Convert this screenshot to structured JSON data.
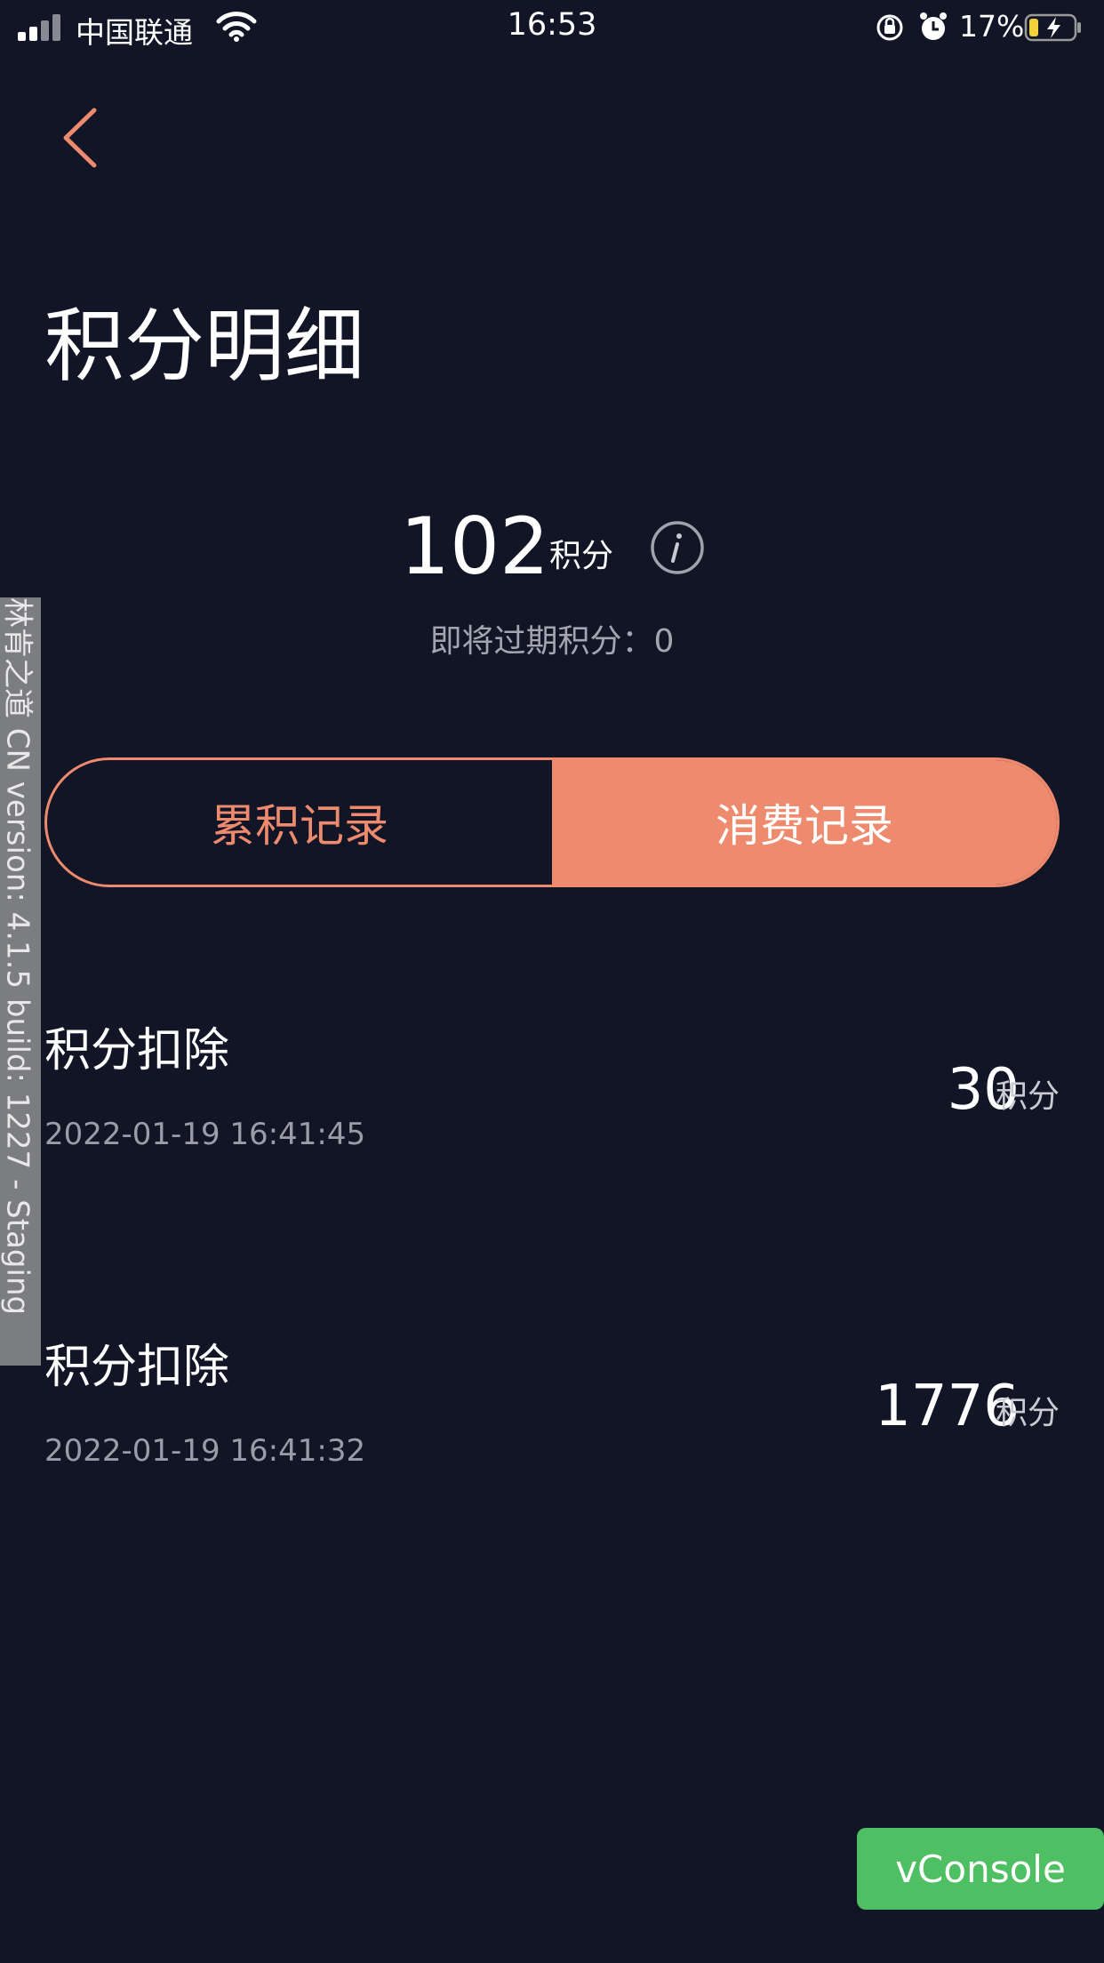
{
  "status_bar": {
    "carrier": "中国联通",
    "time": "16:53",
    "battery_percent": "17%",
    "battery_level": 0.17,
    "icons": [
      "signal-icon",
      "wifi-icon",
      "orientation-lock-icon",
      "alarm-icon",
      "battery-charging-icon"
    ]
  },
  "header": {
    "back_icon": "chevron-left-icon",
    "title": "积分明细"
  },
  "summary": {
    "points": "102",
    "unit": "积分",
    "info_icon": "info-icon",
    "expiring_label": "即将过期积分：0"
  },
  "tabs": [
    {
      "label": "累积记录",
      "active": false
    },
    {
      "label": "消费记录",
      "active": true
    }
  ],
  "records": [
    {
      "title": "积分扣除",
      "date": "2022-01-19 16:41:45",
      "amount": "30",
      "unit": "积分"
    },
    {
      "title": "积分扣除",
      "date": "2022-01-19 16:41:32",
      "amount": "1776",
      "unit": "积分"
    }
  ],
  "watermark": "林肯之道 CN version: 4.1.5 build: 1227 - Staging",
  "vconsole": {
    "label": "vConsole"
  },
  "colors": {
    "background": "#111526",
    "accent": "#ee8a6e",
    "vconsole": "#4fbf63"
  }
}
